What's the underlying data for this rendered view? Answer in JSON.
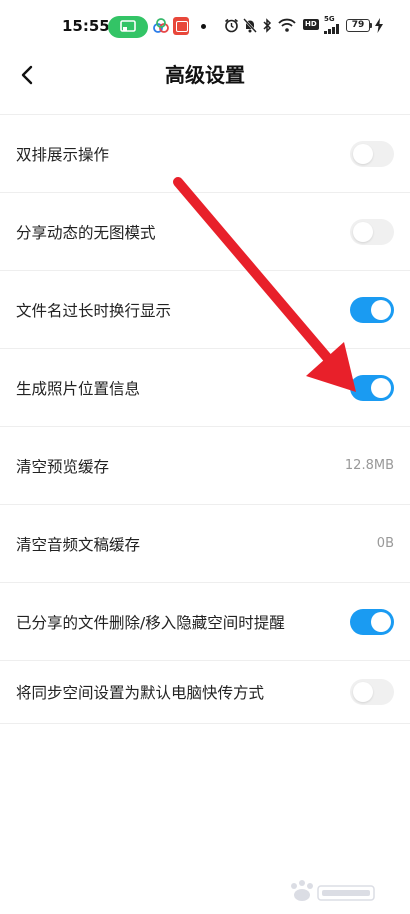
{
  "status_bar": {
    "time": "15:55",
    "battery": "79",
    "network_badge": "HD",
    "signal_label": "5G"
  },
  "header": {
    "title": "高级设置",
    "back_icon": "chevron-left-icon"
  },
  "settings": [
    {
      "label": "双排展示操作",
      "type": "toggle",
      "enabled": false
    },
    {
      "label": "分享动态的无图模式",
      "type": "toggle",
      "enabled": false
    },
    {
      "label": "文件名过长时换行显示",
      "type": "toggle",
      "enabled": true
    },
    {
      "label": "生成照片位置信息",
      "type": "toggle",
      "enabled": true
    },
    {
      "label": "清空预览缓存",
      "type": "value",
      "value": "12.8MB"
    },
    {
      "label": "清空音频文稿缓存",
      "type": "value",
      "value": "0B"
    },
    {
      "label": "已分享的文件删除/移入隐藏空间时提醒",
      "type": "toggle",
      "enabled": true
    },
    {
      "label": "将同步空间设置为默认电脑快传方式",
      "type": "toggle",
      "enabled": false
    }
  ],
  "colors": {
    "toggle_on": "#1a9bf2",
    "toggle_off": "#f0f0f0",
    "annotation_arrow": "#e8202a",
    "cast_pill": "#33c466"
  }
}
